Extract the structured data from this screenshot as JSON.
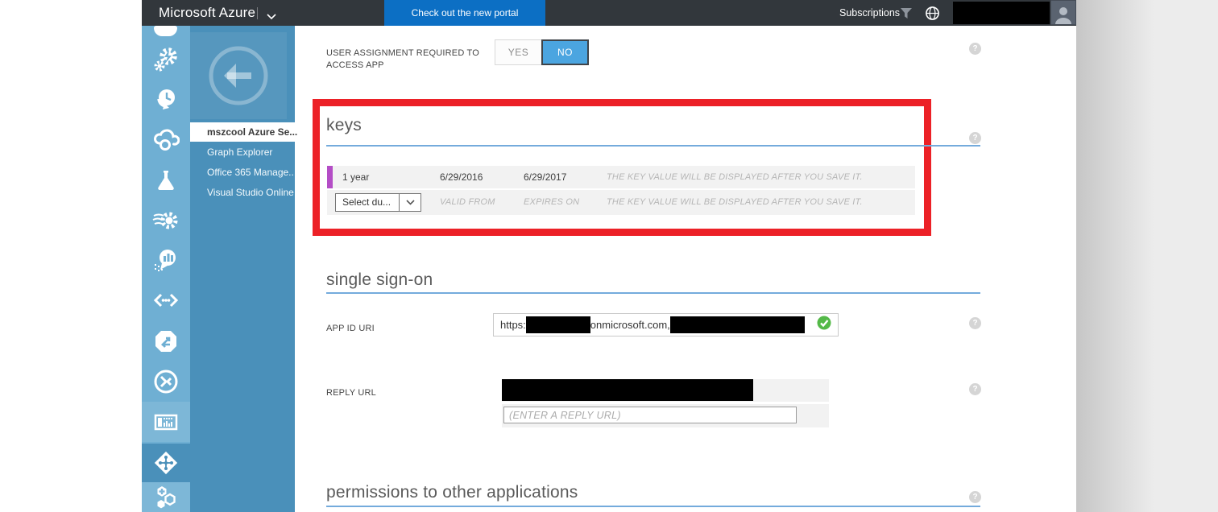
{
  "colors": {
    "topbar_bg": "#32373C",
    "portal_button_bg": "#0C6FC4",
    "icon_strip_bg": "#6FAFD3",
    "sidebar_bg": "#4A90BA",
    "section_underline_blue": "#74ABDC",
    "row_bg": "#F2F2F2",
    "key_row_accent_purple": "#B44DC6",
    "toggle_selected_blue": "#4BA5E0",
    "annotation_red": "#EC2127",
    "valid_check_green": "#54B948"
  },
  "topbar": {
    "brand": "Microsoft Azure",
    "new_portal_button": "Check out the new portal",
    "subscriptions_label": "Subscriptions"
  },
  "sidebar_icons": [
    "automation-icon",
    "scheduler-icon",
    "remoteapp-cloud-icon",
    "labs-flask-icon",
    "stream-analytics-gear-icon",
    "analytics-bubble-icon",
    "code-brackets-icon",
    "sync-octagon-icon",
    "integration-circle-icon",
    "media-mixer-icon",
    "active-directory-icon",
    "marketplace-hexagons-icon"
  ],
  "nav": {
    "items": [
      {
        "label": "mszcool Azure Se...",
        "selected": true
      },
      {
        "label": "Graph Explorer",
        "selected": false
      },
      {
        "label": "Office 365 Manage...",
        "selected": false
      },
      {
        "label": "Visual Studio Online",
        "selected": false
      }
    ]
  },
  "main": {
    "user_assignment": {
      "label": "USER ASSIGNMENT REQUIRED TO ACCESS APP",
      "yes": "YES",
      "no": "NO",
      "selected": "NO"
    },
    "keys": {
      "heading": "keys",
      "row_saved": {
        "duration": "1 year",
        "valid_from": "6/29/2016",
        "expires_on": "6/29/2017",
        "note": "THE KEY VALUE WILL BE DISPLAYED AFTER YOU SAVE IT."
      },
      "row_new": {
        "duration_select": "Select du...",
        "valid_from": "VALID FROM",
        "expires_on": "EXPIRES ON",
        "note": "THE KEY VALUE WILL BE DISPLAYED AFTER YOU SAVE IT."
      }
    },
    "sso": {
      "heading": "single sign-on",
      "app_id_uri_label": "APP ID URI",
      "app_id_uri_prefix": "https:",
      "app_id_uri_middle": "onmicrosoft.com,",
      "reply_url_label": "REPLY URL",
      "reply_url_placeholder": "(ENTER A REPLY URL)"
    },
    "permissions_heading": "permissions to other applications"
  },
  "glyphs": {
    "help": "?"
  }
}
